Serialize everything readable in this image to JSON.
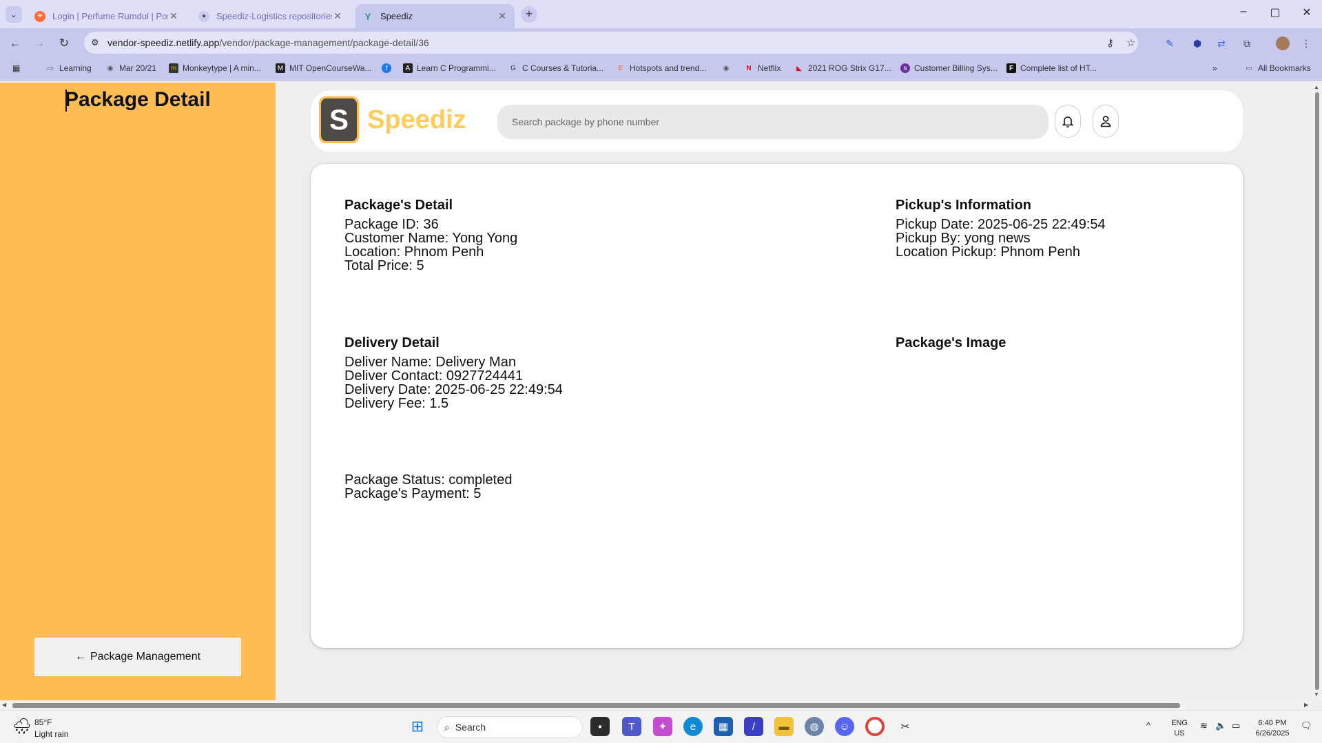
{
  "browser": {
    "tabs": [
      {
        "title": "Login | Perfume Rumdul | Postm",
        "favicon": "postman-icon",
        "color": "#ff6c37"
      },
      {
        "title": "Speediz-Logistics repositories",
        "favicon": "github-icon",
        "color": "#ffffff"
      },
      {
        "title": "Speediz",
        "favicon": "netlify-icon",
        "color": "#2a9d8f"
      }
    ],
    "new_tab_symbol": "+",
    "url_host": "vendor-speediz.netlify.app",
    "url_path": "/vendor/package-management/package-detail/36",
    "window_controls": {
      "minimize": "–",
      "maximize": "▢",
      "close": "✕"
    },
    "bookmarks": [
      {
        "label": "Learning",
        "icon": "folder-icon"
      },
      {
        "label": "Mar 20/21",
        "icon": "globe-icon"
      },
      {
        "label": "Monkeytype | A min...",
        "icon": "monkeytype-icon"
      },
      {
        "label": "MIT OpenCourseWa...",
        "icon": "mit-icon"
      },
      {
        "label": "",
        "icon": "facebook-icon"
      },
      {
        "label": "Learn C Programmi...",
        "icon": "learnc-icon"
      },
      {
        "label": "C Courses & Tutoria...",
        "icon": "courses-icon"
      },
      {
        "label": "Hotspots and trend...",
        "icon": "hotspots-icon"
      },
      {
        "label": "",
        "icon": "globe-icon"
      },
      {
        "label": "Netflix",
        "icon": "netflix-icon"
      },
      {
        "label": "2021 ROG Strix G17...",
        "icon": "rog-icon"
      },
      {
        "label": "Customer Billing Sys...",
        "icon": "billing-icon"
      },
      {
        "label": "Complete list of HT...",
        "icon": "ff-icon"
      }
    ],
    "all_bookmarks": "All Bookmarks"
  },
  "sidebar": {
    "title": "Package Detail",
    "back_button": "Package Management",
    "back_arrow": "🡐",
    "accent": "#ffbc52"
  },
  "header": {
    "logo_letter": "S",
    "brand": "Speediz",
    "search_placeholder": "Search package by phone number"
  },
  "details": {
    "package": {
      "title": "Package's Detail",
      "lines": [
        "Package ID: 36",
        "Customer Name: Yong Yong",
        "Location: Phnom Penh",
        "Total Price: 5"
      ]
    },
    "pickup": {
      "title": "Pickup's Information",
      "lines": [
        "Pickup Date: 2025-06-25 22:49:54",
        "Pickup By: yong news",
        "Location Pickup: Phnom Penh"
      ]
    },
    "delivery": {
      "title": "Delivery Detail",
      "lines": [
        "Deliver Name: Delivery Man",
        "Deliver Contact: 0927724441",
        "Delivery Date: 2025-06-25 22:49:54",
        "Delivery Fee: 1.5"
      ]
    },
    "image": {
      "title": "Package's Image"
    },
    "status": {
      "lines": [
        "Package Status: completed",
        "Package's Payment: 5"
      ]
    }
  },
  "taskbar": {
    "weather_temp": "85°F",
    "weather_desc": "Light rain",
    "search_label": "Search",
    "lang_top": "ENG",
    "lang_bottom": "US",
    "time": "6:40 PM",
    "date": "6/26/2025"
  }
}
